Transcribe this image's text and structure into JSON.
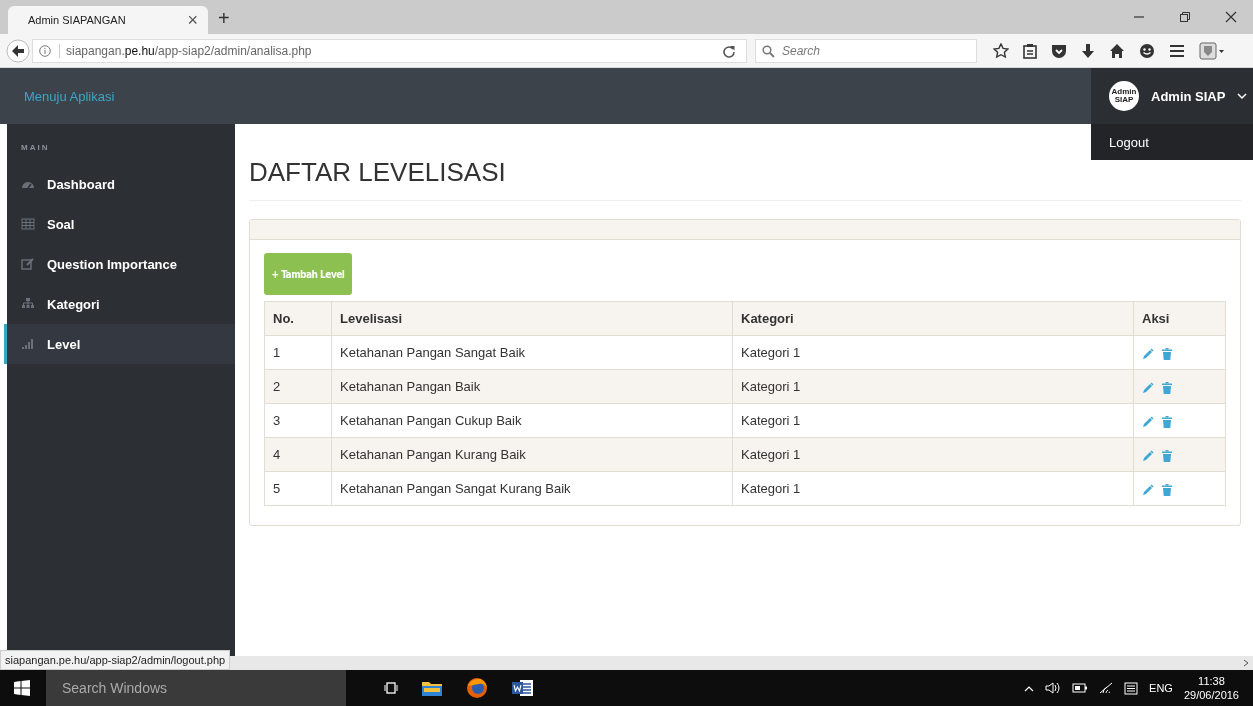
{
  "browser": {
    "tab_title": "Admin SIAPANGAN",
    "tab_close": "×",
    "new_tab": "+",
    "url": "siapangan.**pe.hu**/app-siap2/admin/analisa.php",
    "search": {
      "placeholder": "Search"
    },
    "status_url": "siapangan.pe.hu/app-siap2/admin/logout.php"
  },
  "header": {
    "brand": "Menuju Aplikasi",
    "avatar_text": "Admin SIAP",
    "user": "Admin SIAP",
    "menu": [
      {
        "label": "Logout"
      }
    ]
  },
  "sidebar": {
    "section": "MAIN",
    "items": [
      {
        "label": "Dashboard",
        "selected": false
      },
      {
        "label": "Soal",
        "selected": false
      },
      {
        "label": "Question Importance",
        "selected": false
      },
      {
        "label": "Kategori",
        "selected": false
      },
      {
        "label": "Level",
        "selected": true
      }
    ]
  },
  "page": {
    "title": "DAFTAR LEVELISASI",
    "add_button": "+ Tambah Level"
  },
  "table": {
    "columns": [
      "No.",
      "Levelisasi",
      "Kategori",
      "Aksi"
    ],
    "rows": [
      {
        "no": "1",
        "level": "Ketahanan Pangan Sangat Baik",
        "category": "Kategori 1"
      },
      {
        "no": "2",
        "level": "Ketahanan Pangan Baik",
        "category": "Kategori 1"
      },
      {
        "no": "3",
        "level": "Ketahanan Pangan Cukup Baik",
        "category": "Kategori 1"
      },
      {
        "no": "4",
        "level": "Ketahanan Pangan Kurang Baik",
        "category": "Kategori 1"
      },
      {
        "no": "5",
        "level": "Ketahanan Pangan Sangat Kurang Baik",
        "category": "Kategori 1"
      }
    ]
  },
  "taskbar": {
    "search_placeholder": "Search Windows",
    "language": "ENG",
    "time": "11:38",
    "date": "29/06/2016"
  }
}
